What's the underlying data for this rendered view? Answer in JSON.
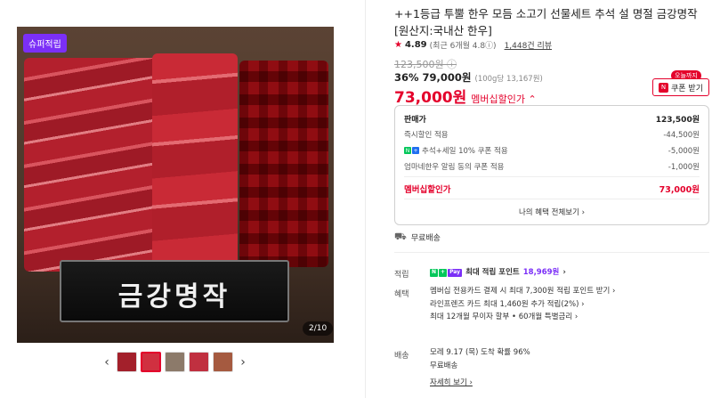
{
  "gallery": {
    "badge": "슈퍼적립",
    "plaque_text": "금강명작",
    "counter": "2/10",
    "prev_arrow": "‹",
    "next_arrow": "›",
    "thumb_count": 5,
    "active_thumb": 2
  },
  "product": {
    "title": "++1등급 투뿔 한우 모듬 소고기 선물세트 추석 설 명절 금강명작 [원산지:국내산 한우]",
    "rating_star": "★",
    "rating": "4.89",
    "rating_detail": "(최근 6개월 4.8ⓘ)",
    "review_count": "1,448건 리뷰",
    "original_price": "123,500원 ⓘ",
    "discount": "36%",
    "sale_price": "79,000원",
    "unit_price": "(100g당 13,167원)",
    "member_price": "73,000원",
    "member_label": "멤버십할인가 ⌃"
  },
  "coupon": {
    "tag": "오늘까지",
    "icon": "N",
    "label": "쿠폰 받기"
  },
  "breakdown": {
    "rows": [
      {
        "label": "판매가",
        "value": "123,500원"
      },
      {
        "label": "즉시할인 적용",
        "value": "-44,500원"
      },
      {
        "label": "추석+세일 10% 쿠폰 적용",
        "value": "-5,000원"
      },
      {
        "label": "엄마네한우 알림 동의 쿠폰 적용",
        "value": "-1,000원"
      }
    ],
    "total_label": "멤버십할인가",
    "total_value": "73,000원",
    "benefits_link": "나의 혜택 전체보기 ›"
  },
  "delivery": {
    "icon": "truck-icon",
    "label": "무료배송"
  },
  "points": {
    "label": "적립",
    "npay_n": "N",
    "npay_p": "+",
    "npay_tag": "Pay",
    "value_prefix": "최대 적립 포인트",
    "value": "18,969원",
    "arrow": "›"
  },
  "benefits": {
    "label": "혜택",
    "lines": [
      "멤버십 전용카드 결제 시 최대 7,300원 적립 포인트 받기 ›",
      "라인프렌즈 카드 최대 1,460원 추가 적립(2%) ›",
      "최대 12개월 무이자 할부 • 60개월 특별금리 ›"
    ]
  },
  "shipping": {
    "label": "배송",
    "lines": [
      "모레 9.17 (목) 도착 확률 96%",
      "무료배송"
    ],
    "detail_link": "자세히 보기 ›"
  }
}
